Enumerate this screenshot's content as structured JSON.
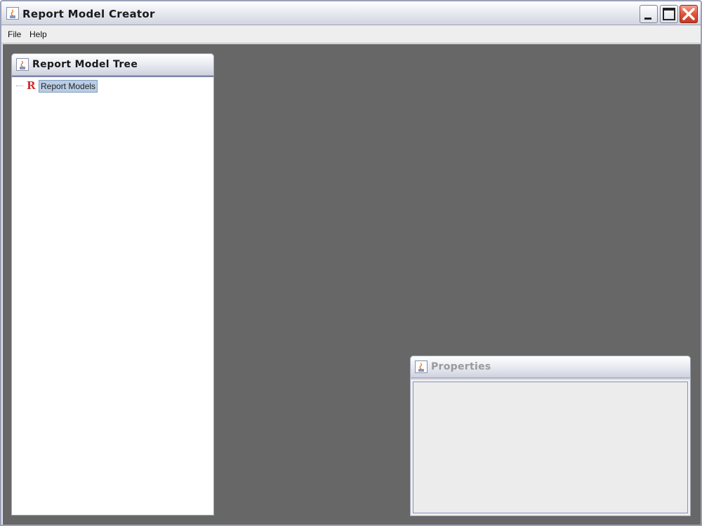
{
  "window": {
    "title": "Report Model Creator"
  },
  "menu": [
    {
      "label": "File"
    },
    {
      "label": "Help"
    }
  ],
  "tree_panel": {
    "title": "Report Model Tree",
    "root": {
      "label": "Report Models",
      "icon": "report-r-icon",
      "selected": true
    }
  },
  "properties_panel": {
    "title": "Properties",
    "active": false
  },
  "colors": {
    "desktop": "#676767",
    "selection": "#b9cde5",
    "root_icon": "#d42a2a"
  }
}
